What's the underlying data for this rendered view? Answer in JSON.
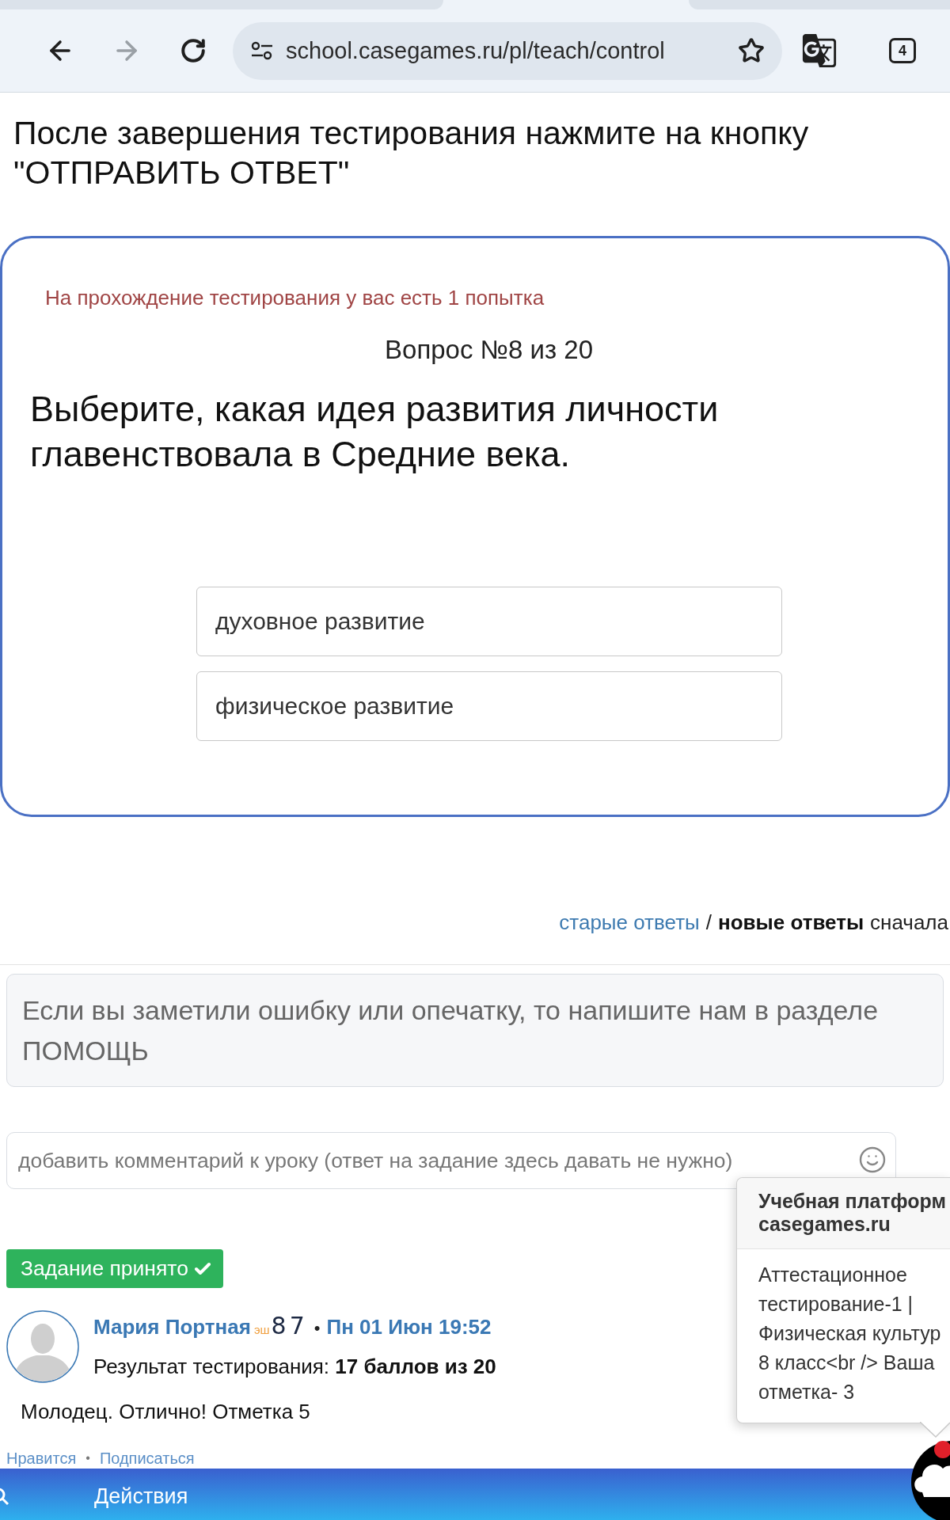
{
  "browser": {
    "forward_disabled": true,
    "url": "school.casegames.ru/pl/teach/control",
    "tab_count": "4"
  },
  "instruction": "После завершения тестирования нажмите на кнопку \"ОТПРАВИТЬ ОТВЕТ\"",
  "test": {
    "attempts_note": "На прохождение тестирования у вас есть 1 попытка",
    "counter": "Вопрос №8 из 20",
    "question": "Выберите, какая идея развития личности главенствовала в Средние века.",
    "options": [
      {
        "label": "духовное развитие",
        "selected": false
      },
      {
        "label": "физическое развитие",
        "selected": false
      }
    ]
  },
  "answer_order": {
    "options": [
      {
        "label": "старые ответы",
        "selected": false
      },
      {
        "label": "новые ответы",
        "selected": true
      }
    ],
    "separator": "/",
    "suffix": "сначала"
  },
  "notice": "Если вы заметили ошибку или опечатку, то напишите нам в разделе ПОМОЩЬ",
  "comment_field": {
    "placeholder": "добавить комментарий к уроку (ответ на задание здесь давать не нужно)"
  },
  "status_badge": {
    "label": "Задание принято",
    "accepted": true
  },
  "answer": {
    "author": "Мария Портная",
    "rank_prefix": "эш",
    "rank_number": "87",
    "separator": "•",
    "date": "Пн 01 Июн 19:52",
    "result": "Результат тестирования: **17 баллов из 20**",
    "comment": "Молодец. Отлично! Отметка 5",
    "actions": [
      "Нравится",
      "Подписаться"
    ],
    "actions_separator": "•"
  },
  "notification": {
    "title_lines": [
      "Учебная платформ",
      "casegames.ru"
    ],
    "body_lines": [
      "Аттестационное",
      "тестирование-1 |",
      "Физическая культур",
      "8 класс<br /> Ваша",
      "отметка- 3"
    ]
  },
  "bottom_bar": {
    "label": "Действия"
  }
}
